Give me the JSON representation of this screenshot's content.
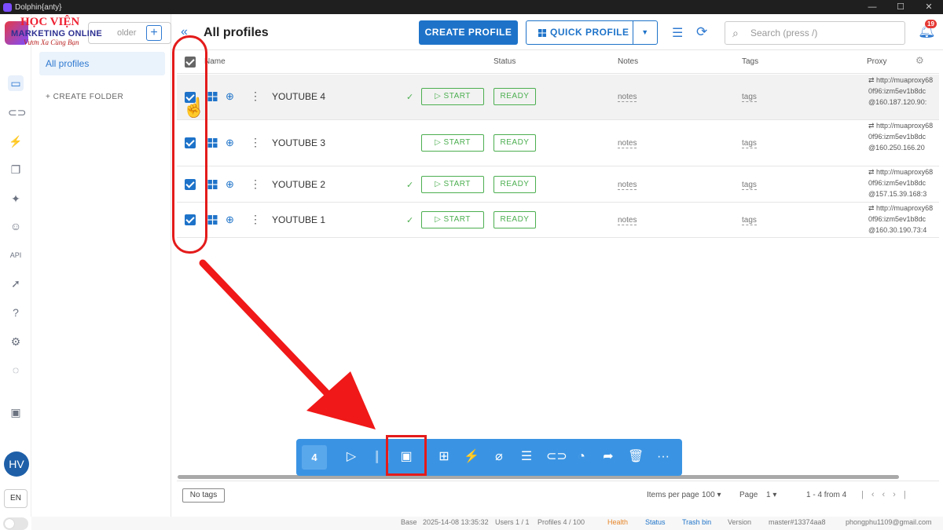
{
  "window": {
    "title": "Dolphin{anty}",
    "controls": [
      "—",
      "☐",
      "✕"
    ]
  },
  "watermark": {
    "line1": "HỌC VIỆN",
    "line2": "MARKETING ONLINE",
    "line3": "Vươn Xa Cùng Bạn"
  },
  "folders": {
    "search_placeholder": "older",
    "items": [
      "All profiles"
    ],
    "create_label": "+ CREATE FOLDER"
  },
  "header": {
    "title": "All profiles",
    "create_profile": "CREATE PROFILE",
    "quick_profile": "QUICK PROFILE",
    "search_placeholder": "Search (press /)",
    "notification_count": "19"
  },
  "table": {
    "columns": [
      "Name",
      "Status",
      "Notes",
      "Tags",
      "Proxy"
    ],
    "rows": [
      {
        "name": "YOUTUBE 4",
        "start": "START",
        "status": "READY",
        "notes": "notes",
        "tags": "tags",
        "proxy1": "http://muaproxy68",
        "proxy2": "0f96:izm5ev1b8dc",
        "proxy3": "@160.187.120.90:"
      },
      {
        "name": "YOUTUBE 3",
        "start": "START",
        "status": "READY",
        "notes": "notes",
        "tags": "tags",
        "proxy1": "http://muaproxy68",
        "proxy2": "0f96:izm5ev1b8dc",
        "proxy3": "@160.250.166.20"
      },
      {
        "name": "YOUTUBE 2",
        "start": "START",
        "status": "READY",
        "notes": "notes",
        "tags": "tags",
        "proxy1": "http://muaproxy68",
        "proxy2": "0f96:izm5ev1b8dc",
        "proxy3": "@157.15.39.168:3"
      },
      {
        "name": "YOUTUBE 1",
        "start": "START",
        "status": "READY",
        "notes": "notes",
        "tags": "tags",
        "proxy1": "http://muaproxy68",
        "proxy2": "0f96:izm5ev1b8dc",
        "proxy3": "@160.30.190.73:4"
      }
    ]
  },
  "footer": {
    "no_tags": "No tags",
    "items_per_page_label": "Items per page",
    "items_per_page": "100",
    "page_label": "Page",
    "page": "1",
    "range": "1 - 4 from 4"
  },
  "action_bar": {
    "selected_count": "4"
  },
  "sidebar": {
    "avatar": "HV",
    "language": "EN"
  },
  "statusbar": {
    "base": "Base",
    "datetime": "2025-14-08 13:35:32",
    "users": "Users 1 / 1",
    "profiles": "Profiles 4 / 100",
    "health": "Health",
    "status": "Status",
    "trash": "Trash bin",
    "version": "Version",
    "build": "master#13374aa8",
    "email": "phongphu1109@gmail.com"
  },
  "colors": {
    "accent": "#1e73c9",
    "success": "#4caf50",
    "highlight": "#e41b1b",
    "actionbar": "#3b94e3"
  }
}
